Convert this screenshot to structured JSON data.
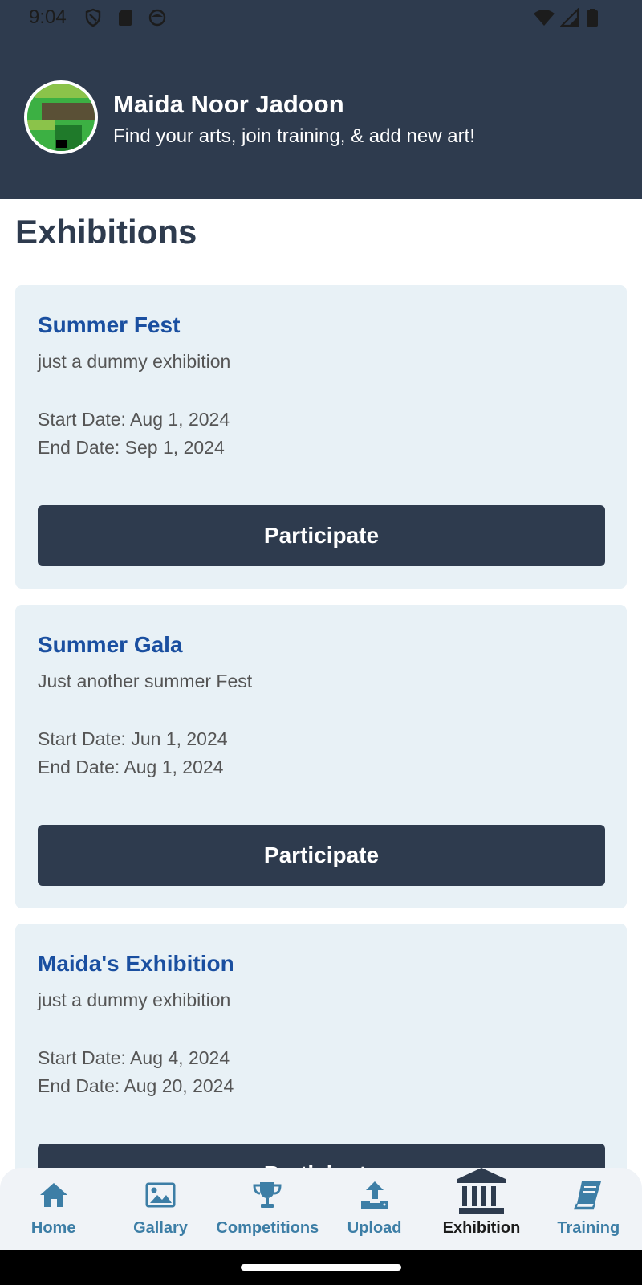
{
  "status_bar": {
    "time": "9:04"
  },
  "header": {
    "name": "Maida Noor Jadoon",
    "tagline": "Find your arts, join training, & add new art!"
  },
  "page_title": "Exhibitions",
  "exhibitions": [
    {
      "title": "Summer Fest",
      "description": "just a dummy exhibition",
      "start": "Start Date: Aug 1, 2024",
      "end": "End Date: Sep 1, 2024",
      "button": "Participate"
    },
    {
      "title": "Summer Gala",
      "description": "Just another summer Fest",
      "start": "Start Date: Jun 1, 2024",
      "end": "End Date: Aug 1, 2024",
      "button": "Participate"
    },
    {
      "title": "Maida's Exhibition",
      "description": "just a dummy exhibition",
      "start": "Start Date: Aug 4, 2024",
      "end": "End Date: Aug 20, 2024",
      "button": "Participate"
    }
  ],
  "nav": [
    {
      "label": "Home",
      "icon": "home-icon"
    },
    {
      "label": "Gallary",
      "icon": "image-icon"
    },
    {
      "label": "Competitions",
      "icon": "trophy-icon"
    },
    {
      "label": "Upload",
      "icon": "upload-icon"
    },
    {
      "label": "Exhibition",
      "icon": "museum-icon",
      "active": true
    },
    {
      "label": "Training",
      "icon": "book-icon"
    }
  ],
  "colors": {
    "header_bg": "#2e3b4e",
    "card_bg": "#e8f1f6",
    "title_blue": "#1a4fa0",
    "nav_accent": "#3d7ea6"
  }
}
